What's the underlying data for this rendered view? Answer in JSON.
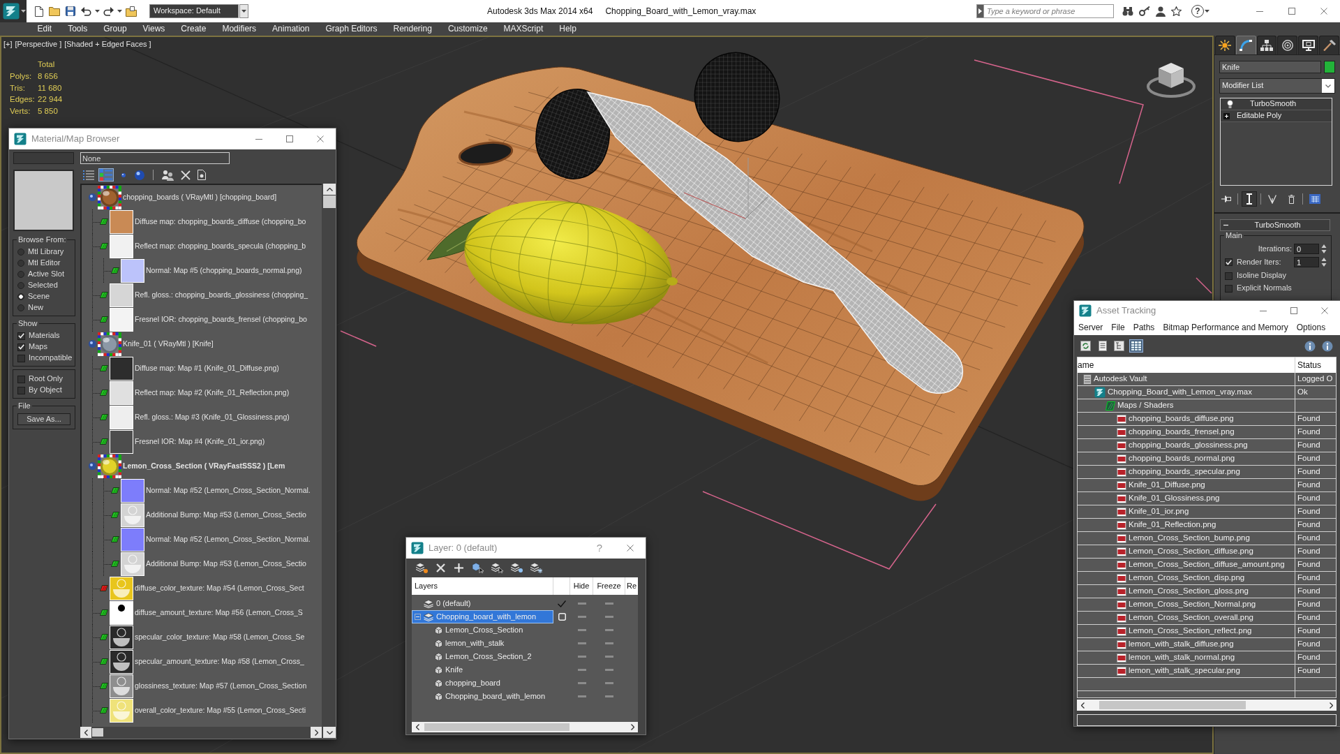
{
  "title_bar": {
    "workspace": "Workspace: Default",
    "app_title": "Autodesk 3ds Max 2014 x64",
    "document": "Chopping_Board_with_Lemon_vray.max",
    "search": {
      "placeholder": "Type a keyword or phrase"
    },
    "help": "?"
  },
  "menu_bar": [
    "Edit",
    "Tools",
    "Group",
    "Views",
    "Create",
    "Modifiers",
    "Animation",
    "Graph Editors",
    "Rendering",
    "Customize",
    "MAXScript",
    "Help"
  ],
  "viewport": {
    "menus": [
      "[+]",
      "[Perspective ]",
      "[Shaded + Edged Faces ]"
    ],
    "stats": {
      "heading": "Total",
      "rows": [
        {
          "label": "Polys:",
          "value": "8 656"
        },
        {
          "label": "Tris:",
          "value": "11 680"
        },
        {
          "label": "Edges:",
          "value": "22 944"
        },
        {
          "label": "Verts:",
          "value": "5 850"
        }
      ]
    }
  },
  "command_panel": {
    "tabs": [
      {
        "kind": "create",
        "selected": false
      },
      {
        "kind": "modify",
        "selected": true
      },
      {
        "kind": "hierarchy",
        "selected": false
      },
      {
        "kind": "motion",
        "selected": false
      },
      {
        "kind": "display",
        "selected": false
      },
      {
        "kind": "utilities",
        "selected": false
      }
    ],
    "object": {
      "name": "Knife",
      "color": "#22b339"
    },
    "modifier_list": "Modifier List",
    "stack": [
      {
        "name": "TurboSmooth",
        "kind": "modifier",
        "on": true,
        "selected": false
      },
      {
        "name": "Editable Poly",
        "kind": "base",
        "expanded": false,
        "selected": false
      }
    ],
    "stack_tools": [
      {
        "kind": "pin",
        "on": false
      },
      {
        "kind": "end-result",
        "on": true
      },
      {
        "kind": "unique",
        "on": false
      },
      {
        "kind": "remove",
        "on": false
      },
      {
        "kind": "configure",
        "on": false
      }
    ],
    "rollout": {
      "title": "TurboSmooth",
      "expanded": true,
      "group": "Main",
      "spinners": [
        {
          "kind": "plain",
          "label": "Iterations:",
          "value": "0"
        },
        {
          "kind": "check",
          "label": "Render Iters:",
          "value": "1",
          "checked": true
        }
      ],
      "options": [
        {
          "label": "Isoline Display",
          "checked": false
        },
        {
          "label": "Explicit Normals",
          "checked": false
        }
      ]
    }
  },
  "material_browser": {
    "title": "Material/Map Browser",
    "filter": "None",
    "browse_from": {
      "title": "Browse From:",
      "options": [
        {
          "label": "Mtl Library",
          "selected": false
        },
        {
          "label": "Mtl Editor",
          "selected": false
        },
        {
          "label": "Active Slot",
          "selected": false
        },
        {
          "label": "Selected",
          "selected": false
        },
        {
          "label": "Scene",
          "selected": true
        },
        {
          "label": "New",
          "selected": false
        }
      ]
    },
    "show": {
      "title": "Show",
      "options": [
        {
          "label": "Materials",
          "checked": true
        },
        {
          "label": "Maps",
          "checked": true
        },
        {
          "label": "Incompatible",
          "checked": false
        }
      ]
    },
    "filters": [
      {
        "label": "Root Only",
        "checked": false
      },
      {
        "label": "By Object",
        "checked": false
      }
    ],
    "file": {
      "title": "File",
      "button": "Save As..."
    },
    "view_modes": [
      {
        "kind": "list",
        "selected": false
      },
      {
        "kind": "list-icons",
        "selected": true
      },
      {
        "kind": "small-icons",
        "selected": false
      },
      {
        "kind": "large-icons",
        "selected": false
      }
    ],
    "materials": [
      {
        "name": "chopping_boards ( VRayMtl ) [chopping_board]",
        "active": false,
        "color": "#a0622f",
        "children": [
          {
            "label": "Diffuse map: chopping_boards_diffuse (chopping_bo",
            "kind": "plain",
            "color": "#c98a55",
            "in_viewport": false
          },
          {
            "label": "Reflect map: chopping_boards_specula (chopping_b",
            "kind": "plain",
            "color": "#f1f1f1",
            "in_viewport": false,
            "children": [
              {
                "label": "Normal: Map #5 (chopping_boards_normal.png)",
                "kind": "plain",
                "color": "#bcc3fb",
                "in_viewport": false
              }
            ]
          },
          {
            "label": "Refl. gloss.: chopping_boards_glossiness (chopping_",
            "kind": "plain",
            "color": "#d6d6d6",
            "in_viewport": false
          },
          {
            "label": "Fresnel IOR: chopping_boards_frensel (chopping_bo",
            "kind": "plain",
            "color": "#f3f3f3",
            "in_viewport": false
          }
        ]
      },
      {
        "name": "Knife_01 ( VRayMtl ) [Knife]",
        "active": false,
        "color": "#8c98a6",
        "children": [
          {
            "label": "Diffuse map: Map #1 (Knife_01_Diffuse.png)",
            "kind": "plain",
            "color": "#2d2d2d",
            "in_viewport": false
          },
          {
            "label": "Reflect map: Map #2 (Knife_01_Reflection.png)",
            "kind": "plain",
            "color": "#e0e0e0",
            "in_viewport": false
          },
          {
            "label": "Refl. gloss.: Map #3 (Knife_01_Glossiness.png)",
            "kind": "plain",
            "color": "#eeeeee",
            "in_viewport": false
          },
          {
            "label": "Fresnel IOR: Map #4 (Knife_01_ior.png)",
            "kind": "plain",
            "color": "#4d4d4d",
            "in_viewport": false
          }
        ]
      },
      {
        "name": "Lemon_Cross_Section ( VRayFastSSS2 ) [Lem",
        "active": true,
        "color": "#e2d22a",
        "children": [
          {
            "children": [
              {
                "label": "Normal: Map #52 (Lemon_Cross_Section_Normal.",
                "kind": "plain",
                "color": "#7d7dfb",
                "in_viewport": false
              },
              {
                "label": "Additional Bump: Map #53 (Lemon_Cross_Sectio",
                "kind": "slice",
                "color": "#d4d4d4",
                "in_viewport": false
              },
              {
                "label": "Normal: Map #52 (Lemon_Cross_Section_Normal.",
                "kind": "plain",
                "color": "#7d7dfb",
                "in_viewport": false
              },
              {
                "label": "Additional Bump: Map #53 (Lemon_Cross_Sectio",
                "kind": "slice",
                "color": "#d4d4d4",
                "in_viewport": false
              }
            ]
          },
          {
            "label": "diffuse_color_texture: Map #54 (Lemon_Cross_Sect",
            "kind": "slice",
            "color": "#e8c51c",
            "in_viewport": true
          },
          {
            "label": "diffuse_amount_texture: Map #56 (Lemon_Cross_S",
            "kind": "dot",
            "color": "#ffffff",
            "in_viewport": false
          },
          {
            "label": "specular_color_texture: Map #58 (Lemon_Cross_Se",
            "kind": "slice",
            "color": "#2a2a2a",
            "in_viewport": false
          },
          {
            "label": "specular_amount_texture: Map #58 (Lemon_Cross_",
            "kind": "slice",
            "color": "#2a2a2a",
            "in_viewport": false
          },
          {
            "label": "glossiness_texture: Map #57 (Lemon_Cross_Section",
            "kind": "slice",
            "color": "#8e8e8e",
            "in_viewport": false
          },
          {
            "label": "overall_color_texture: Map #55 (Lemon_Cross_Secti",
            "kind": "slice",
            "color": "#efe27a",
            "in_viewport": false
          }
        ]
      }
    ]
  },
  "layer_window": {
    "title": "Layer: 0 (default)",
    "help": "?",
    "columns": [
      "Layers",
      "Hide",
      "Freeze",
      "Re"
    ],
    "layers": [
      {
        "name": "0 (default)",
        "kind": "layer",
        "current": true,
        "selected": false,
        "hidden": false,
        "frozen": false
      },
      {
        "name": "Chopping_board_with_lemon",
        "kind": "layer",
        "current": false,
        "selected": true,
        "expanded": true,
        "hidden": false,
        "frozen": false,
        "children": [
          {
            "name": "Lemon_Cross_Section",
            "kind": "object",
            "selected": false,
            "hidden": false,
            "frozen": false
          },
          {
            "name": "lemon_with_stalk",
            "kind": "object",
            "selected": false,
            "hidden": false,
            "frozen": false
          },
          {
            "name": "Lemon_Cross_Section_2",
            "kind": "object",
            "selected": false,
            "hidden": false,
            "frozen": false
          },
          {
            "name": "Knife",
            "kind": "object",
            "selected": false,
            "hidden": false,
            "frozen": false
          },
          {
            "name": "chopping_board",
            "kind": "object",
            "selected": false,
            "hidden": false,
            "frozen": false
          },
          {
            "name": "Chopping_board_with_lemon",
            "kind": "object",
            "selected": false,
            "hidden": false,
            "frozen": false
          }
        ]
      }
    ]
  },
  "asset_tracking": {
    "title": "Asset Tracking",
    "menu": [
      "Server",
      "File",
      "Paths",
      "Bitmap Performance and Memory",
      "Options"
    ],
    "view_modes": [
      {
        "kind": "list",
        "selected": false
      },
      {
        "kind": "tree",
        "selected": false
      },
      {
        "kind": "table",
        "selected": true
      }
    ],
    "columns": [
      "ame",
      "Status"
    ],
    "assets": [
      {
        "name": "Autodesk Vault",
        "kind": "vault",
        "status": "Logged O",
        "children": [
          {
            "name": "Chopping_Board_with_Lemon_vray.max",
            "kind": "scene",
            "status": "Ok",
            "children": [
              {
                "name": "Maps / Shaders",
                "kind": "folder",
                "children": [
                  {
                    "name": "chopping_boards_diffuse.png",
                    "kind": "image",
                    "status": "Found"
                  },
                  {
                    "name": "chopping_boards_frensel.png",
                    "kind": "image",
                    "status": "Found"
                  },
                  {
                    "name": "chopping_boards_glossiness.png",
                    "kind": "image",
                    "status": "Found"
                  },
                  {
                    "name": "chopping_boards_normal.png",
                    "kind": "image",
                    "status": "Found"
                  },
                  {
                    "name": "chopping_boards_specular.png",
                    "kind": "image",
                    "status": "Found"
                  },
                  {
                    "name": "Knife_01_Diffuse.png",
                    "kind": "image",
                    "status": "Found"
                  },
                  {
                    "name": "Knife_01_Glossiness.png",
                    "kind": "image",
                    "status": "Found"
                  },
                  {
                    "name": "Knife_01_ior.png",
                    "kind": "image",
                    "status": "Found"
                  },
                  {
                    "name": "Knife_01_Reflection.png",
                    "kind": "image",
                    "status": "Found"
                  },
                  {
                    "name": "Lemon_Cross_Section_bump.png",
                    "kind": "image",
                    "status": "Found"
                  },
                  {
                    "name": "Lemon_Cross_Section_diffuse.png",
                    "kind": "image",
                    "status": "Found"
                  },
                  {
                    "name": "Lemon_Cross_Section_diffuse_amount.png",
                    "kind": "image",
                    "status": "Found"
                  },
                  {
                    "name": "Lemon_Cross_Section_disp.png",
                    "kind": "image",
                    "status": "Found"
                  },
                  {
                    "name": "Lemon_Cross_Section_gloss.png",
                    "kind": "image",
                    "status": "Found"
                  },
                  {
                    "name": "Lemon_Cross_Section_Normal.png",
                    "kind": "image",
                    "status": "Found"
                  },
                  {
                    "name": "Lemon_Cross_Section_overall.png",
                    "kind": "image",
                    "status": "Found"
                  },
                  {
                    "name": "Lemon_Cross_Section_reflect.png",
                    "kind": "image",
                    "status": "Found"
                  },
                  {
                    "name": "lemon_with_stalk_diffuse.png",
                    "kind": "image",
                    "status": "Found"
                  },
                  {
                    "name": "lemon_with_stalk_normal.png",
                    "kind": "image",
                    "status": "Found"
                  },
                  {
                    "name": "lemon_with_stalk_specular.png",
                    "kind": "image",
                    "status": "Found"
                  }
                ]
              }
            ]
          }
        ]
      }
    ]
  }
}
